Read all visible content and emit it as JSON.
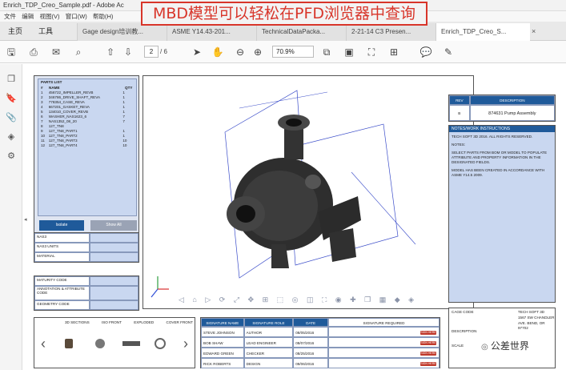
{
  "window": {
    "title": "Enrich_TDP_Creo_Sample.pdf - Adobe Ac"
  },
  "banner": {
    "text": "MBD模型可以轻松在PFD浏览器中查询"
  },
  "menu": [
    "文件",
    "编辑",
    "视图(V)",
    "窗口(W)",
    "帮助(H)"
  ],
  "nav_tabs": [
    "主页",
    "工具"
  ],
  "doc_tabs": [
    "Gage design培训教...",
    "ASME Y14.43-201...",
    "TechnicalDataPacka...",
    "2-21-14 C3 Presen...",
    "Enrich_TDP_Creo_S..."
  ],
  "toolbar": {
    "page_current": "2",
    "page_total": "/ 6",
    "zoom": "70.9%"
  },
  "parts_list": {
    "title": "PARTS LIST",
    "columns": [
      "#",
      "NAME",
      "QTY"
    ],
    "rows": [
      [
        "1",
        "456722_IMPELLER_REVB",
        "1"
      ],
      [
        "2",
        "346786_DRIVE_SHAFT_REVA",
        "1"
      ],
      [
        "3",
        "778354_CASE_REVA",
        "1"
      ],
      [
        "4",
        "667201_GASKET_REVA",
        "1"
      ],
      [
        "5",
        "134010_COVER_REVB",
        "1"
      ],
      [
        "6",
        "WASHER_NAS1623_6",
        "7"
      ],
      [
        "7",
        "NAS1352_08_20",
        "7"
      ],
      [
        "8",
        "127_TN8",
        ""
      ],
      [
        "9",
        "127_TN8_PART1",
        "1"
      ],
      [
        "10",
        "127_TN8_PART2",
        "1"
      ],
      [
        "11",
        "127_TN8_PART3",
        "10"
      ],
      [
        "12",
        "127_TN8_PART4",
        "10"
      ]
    ],
    "isolate_label": "Isolate",
    "show_all_label": "Show All"
  },
  "attribute_fields": [
    "NAS3",
    "NAS3 UNITS",
    "MATERIAL"
  ],
  "maturity_fields": [
    "MATURITY CODE",
    "ANNOTATION & ATTRIBUTE CODE",
    "GEOMETRY CODE"
  ],
  "views": {
    "labels": [
      "3D SECTIONS",
      "ISO FRONT",
      "EXPLODED",
      "COVER FRONT"
    ]
  },
  "signatures": {
    "columns": [
      "SIGNATURE NAME",
      "SIGNATURE ROLE",
      "DATE",
      "SIGNATURE REQUIRED"
    ],
    "rows": [
      [
        "STEVE JOHNSON",
        "AUTHOR",
        "08/05/2016"
      ],
      [
        "BOB SHAW",
        "LEAD ENGINEER",
        "08/07/2016"
      ],
      [
        "EDWARD GREEN",
        "CHECKER",
        "08/25/2016"
      ],
      [
        "RICK ROBERTS",
        "DESIGN",
        "09/06/2016"
      ]
    ],
    "sign_label": "SIGN HERE"
  },
  "rev_table": {
    "columns": [
      "REV",
      "DESCRIPTION"
    ],
    "rev": "B",
    "description": "874631 Pump Assembly"
  },
  "notes": {
    "title": "NOTES/WORK INSTRUCTIONS",
    "lines": [
      "TECH SOFT 3D 2016. ALL RIGHTS RESERVED.",
      "NOTES:",
      "SELECT PARTS FROM BOM OR MODEL TO POPULATE ATTRIBUTE AND PROPERTY INFORMATION IN THE DESIGNATED FIELDS.",
      "MODEL HAS BEEN CREATED IN ACCORDANCE WITH ASME Y14.5 2009."
    ]
  },
  "title_block": {
    "cage_code": "CAGE CODE",
    "company": "TECH SOFT 3D",
    "addr1": "1567 SW CHANDLER",
    "addr2": "AVE. BEND, OR 97702",
    "description": "DESCRIPTION",
    "scale": "SCALE"
  },
  "watermark": {
    "text": "公差世界"
  },
  "colors": {
    "accent_red": "#d8352a",
    "header_blue": "#1f5a9a",
    "field_blue": "#c9d7f0"
  }
}
